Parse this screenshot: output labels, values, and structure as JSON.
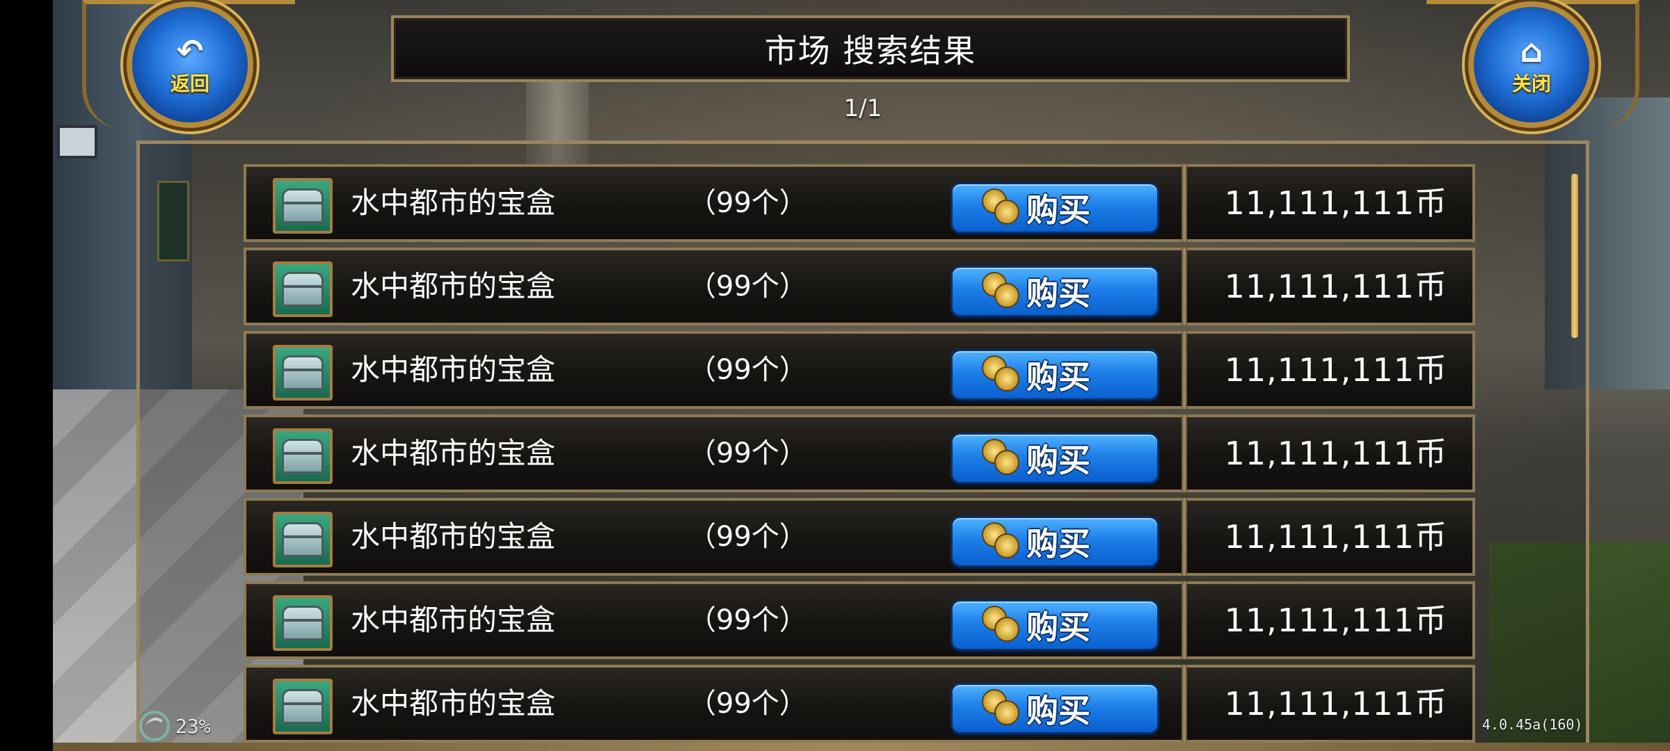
{
  "nav": {
    "back_label": "返回",
    "close_label": "关闭",
    "back_icon": "back-arrow-icon",
    "close_icon": "home-icon"
  },
  "header": {
    "title": "市场 搜索结果",
    "page_indicator": "1/1"
  },
  "results": [
    {
      "name": "水中都市的宝盒",
      "qty": "（99个）",
      "buy_label": "购买",
      "price": "11,111,111币"
    },
    {
      "name": "水中都市的宝盒",
      "qty": "（99个）",
      "buy_label": "购买",
      "price": "11,111,111币"
    },
    {
      "name": "水中都市的宝盒",
      "qty": "（99个）",
      "buy_label": "购买",
      "price": "11,111,111币"
    },
    {
      "name": "水中都市的宝盒",
      "qty": "（99个）",
      "buy_label": "购买",
      "price": "11,111,111币"
    },
    {
      "name": "水中都市的宝盒",
      "qty": "（99个）",
      "buy_label": "购买",
      "price": "11,111,111币"
    },
    {
      "name": "水中都市的宝盒",
      "qty": "（99个）",
      "buy_label": "购买",
      "price": "11,111,111币"
    },
    {
      "name": "水中都市的宝盒",
      "qty": "（99个）",
      "buy_label": "购买",
      "price": "11,111,111币"
    }
  ],
  "footer": {
    "status_text": "23%",
    "version": "4.0.45a(160)"
  },
  "colors": {
    "accent_gold": "#9a8560",
    "button_blue": "#1d7fe8",
    "label_yellow": "#ffe14a"
  }
}
